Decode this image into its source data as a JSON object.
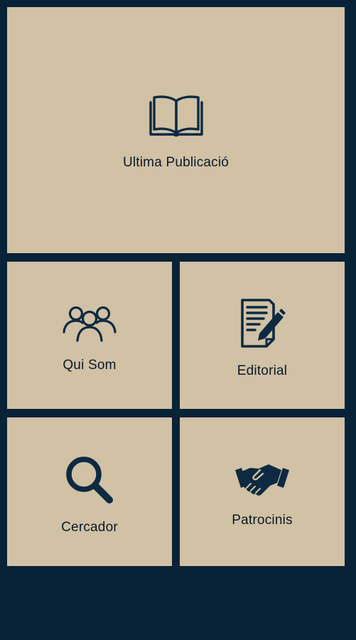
{
  "colors": {
    "background": "#082238",
    "tile": "#d1c1a5",
    "icon": "#0d2a42",
    "text": "#0b1a27"
  },
  "menu": {
    "publication": {
      "label": "Ultima Publicació",
      "icon": "open-book-icon"
    },
    "qui_som": {
      "label": "Qui Som",
      "icon": "people-group-icon"
    },
    "editorial": {
      "label": "Editorial",
      "icon": "document-edit-icon"
    },
    "cercador": {
      "label": "Cercador",
      "icon": "search-icon"
    },
    "patrocinis": {
      "label": "Patrocinis",
      "icon": "handshake-icon"
    }
  }
}
